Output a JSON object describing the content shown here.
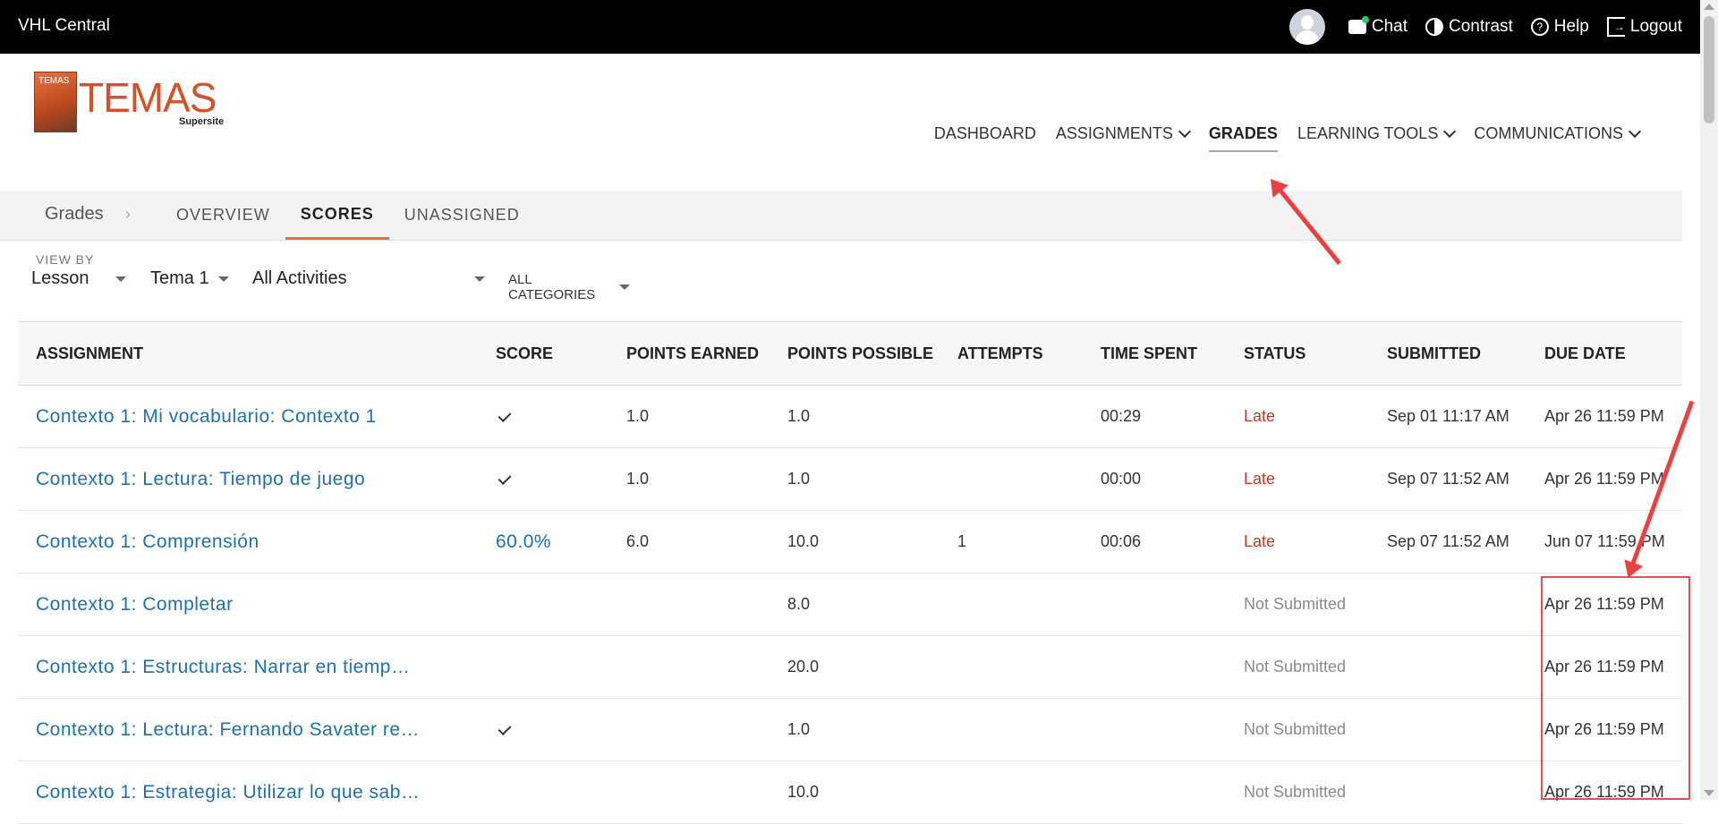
{
  "topbar": {
    "brand": "VHL Central",
    "chat": "Chat",
    "contrast": "Contrast",
    "help": "Help",
    "logout": "Logout"
  },
  "logo": {
    "word": "TEMAS",
    "book_text": "TEMAS",
    "sub": "Supersite"
  },
  "mainnav": {
    "dashboard": "DASHBOARD",
    "assignments": "ASSIGNMENTS",
    "grades": "GRADES",
    "learning_tools": "LEARNING TOOLS",
    "communications": "COMMUNICATIONS"
  },
  "subnav": {
    "crumb": "Grades",
    "tabs": [
      "OVERVIEW",
      "SCORES",
      "UNASSIGNED"
    ]
  },
  "filters": {
    "view_by_label": "VIEW BY",
    "view_by": "Lesson",
    "lesson": "Tema 1",
    "activities": "All Activities",
    "categories": "ALL CATEGORIES"
  },
  "table": {
    "headers": {
      "assignment": "ASSIGNMENT",
      "score": "SCORE",
      "points_earned": "POINTS EARNED",
      "points_possible": "POINTS POSSIBLE",
      "attempts": "ATTEMPTS",
      "time_spent": "TIME SPENT",
      "status": "STATUS",
      "submitted": "SUBMITTED",
      "due_date": "DUE DATE"
    },
    "rows": [
      {
        "assignment": "Contexto 1: Mi vocabulario: Contexto 1",
        "score": "",
        "points_earned": "1.0",
        "points_possible": "1.0",
        "attempts": "",
        "time_spent": "00:29",
        "status": "Late",
        "submitted": "Sep 01 11:17 AM",
        "due_date": "Apr 26 11:59 PM"
      },
      {
        "assignment": "Contexto 1: Lectura: Tiempo de juego",
        "score": "",
        "points_earned": "1.0",
        "points_possible": "1.0",
        "attempts": "",
        "time_spent": "00:00",
        "status": "Late",
        "submitted": "Sep 07 11:52 AM",
        "due_date": "Apr 26 11:59 PM"
      },
      {
        "assignment": "Contexto 1: Comprensión",
        "score": "60.0%",
        "points_earned": "6.0",
        "points_possible": "10.0",
        "attempts": "1",
        "time_spent": "00:06",
        "status": "Late",
        "submitted": "Sep 07 11:52 AM",
        "due_date": "Jun 07 11:59 PM"
      },
      {
        "assignment": "Contexto 1: Completar",
        "score": "",
        "points_earned": "",
        "points_possible": "8.0",
        "attempts": "",
        "time_spent": "",
        "status": "Not Submitted",
        "submitted": "",
        "due_date": "Apr 26 11:59 PM"
      },
      {
        "assignment": "Contexto 1: Estructuras: Narrar en tiemp…",
        "score": "",
        "points_earned": "",
        "points_possible": "20.0",
        "attempts": "",
        "time_spent": "",
        "status": "Not Submitted",
        "submitted": "",
        "due_date": "Apr 26 11:59 PM"
      },
      {
        "assignment": "Contexto 1: Lectura: Fernando Savater re…",
        "score": "",
        "points_earned": "",
        "points_possible": "1.0",
        "attempts": "",
        "time_spent": "",
        "status": "Not Submitted",
        "submitted": "",
        "due_date": "Apr 26 11:59 PM"
      },
      {
        "assignment": "Contexto 1: Estrategia: Utilizar lo que sab…",
        "score": "",
        "points_earned": "",
        "points_possible": "10.0",
        "attempts": "",
        "time_spent": "",
        "status": "Not Submitted",
        "submitted": "",
        "due_date": "Apr 26 11:59 PM"
      }
    ]
  },
  "colors": {
    "topbar_bg": "#000000",
    "link_blue": "#1f6fad",
    "late_red": "#c0392b",
    "tab_accent": "#e07338",
    "annotation_red": "#ec4040"
  }
}
